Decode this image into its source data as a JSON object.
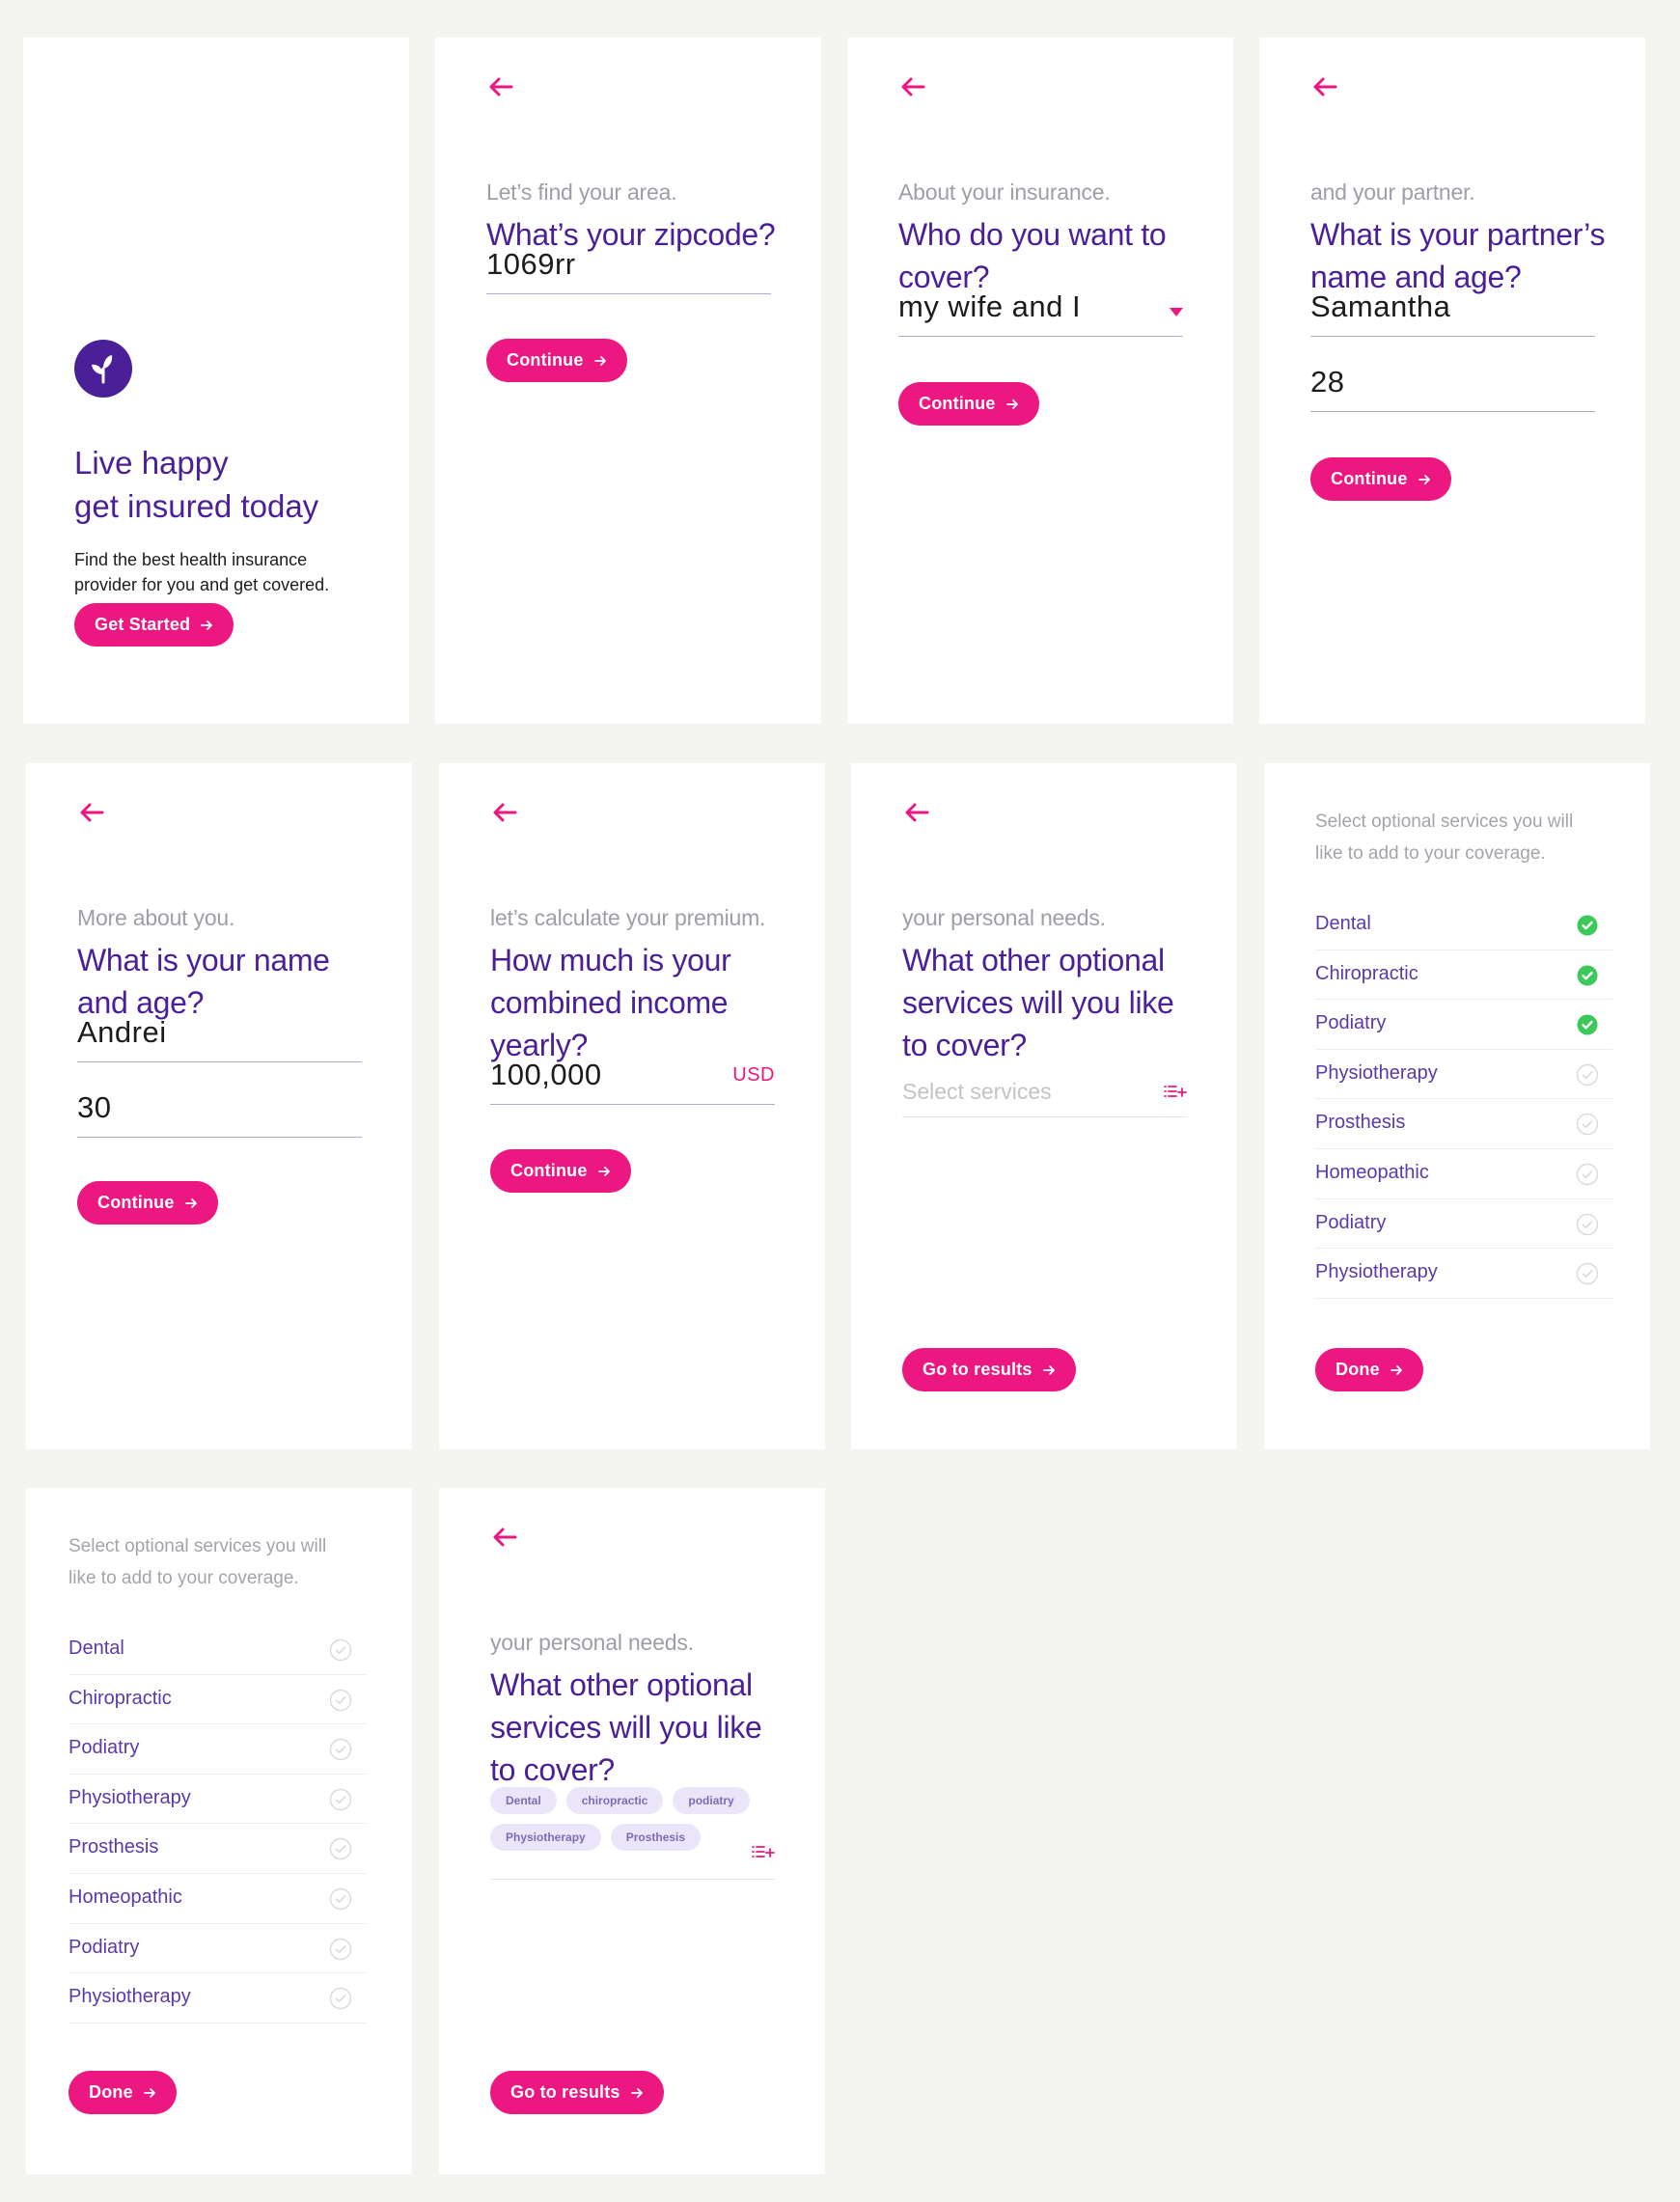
{
  "colors": {
    "accent": "#ec1780",
    "primary": "#4a1f98",
    "page_background": "#f4f4f0",
    "check_selected": "#3dc85a",
    "check_unselected": "#d9d9de"
  },
  "icons": {
    "back": "arrow-left-icon",
    "button_arrow": "arrow-right-icon",
    "logo": "sprout-icon",
    "dropdown": "caret-down-icon",
    "list_add": "list-add-icon",
    "check": "check-circle-icon"
  },
  "welcome": {
    "title_line1": "Live happy",
    "title_line2": "get insured today",
    "subtitle_line1": "Find the best health insurance",
    "subtitle_line2": "provider for you and get covered.",
    "button": "Get Started"
  },
  "zipcode": {
    "eyebrow": "Let’s find your area.",
    "question": "What’s your zipcode?",
    "value": "1069rr",
    "button": "Continue"
  },
  "cover": {
    "eyebrow": "About your insurance.",
    "question_line1": "Who do you want to",
    "question_line2": "cover?",
    "selected": "my wife and I",
    "button": "Continue"
  },
  "partner": {
    "eyebrow": "and your partner.",
    "question_line1": "What is your partner’s",
    "question_line2": "name and age?",
    "name": "Samantha",
    "age": "28",
    "button": "Continue"
  },
  "you": {
    "eyebrow": "More about you.",
    "question_line1": "What is your name",
    "question_line2": "and age?",
    "name": "Andrei",
    "age": "30",
    "button": "Continue"
  },
  "income": {
    "eyebrow": "let’s calculate your premium.",
    "question_line1": "How much is your",
    "question_line2": "combined income",
    "question_line3": "yearly?",
    "value": "100,000",
    "currency": "USD",
    "button": "Continue"
  },
  "services_empty": {
    "eyebrow": "your personal needs.",
    "question_line1": "What other optional",
    "question_line2": "services will you like",
    "question_line3": "to cover?",
    "placeholder": "Select services",
    "button": "Go to results"
  },
  "services_select": {
    "header_line1": "Select optional services you will",
    "header_line2": "like to add to your coverage.",
    "items": [
      {
        "label": "Dental",
        "selected": true
      },
      {
        "label": "Chiropractic",
        "selected": true
      },
      {
        "label": "Podiatry",
        "selected": true
      },
      {
        "label": "Physiotherapy",
        "selected": false
      },
      {
        "label": "Prosthesis",
        "selected": false
      },
      {
        "label": "Homeopathic",
        "selected": false
      },
      {
        "label": "Podiatry",
        "selected": false
      },
      {
        "label": "Physiotherapy",
        "selected": false
      }
    ],
    "button": "Done"
  },
  "services_select_empty": {
    "header_line1": "Select optional services you will",
    "header_line2": "like to add to your coverage.",
    "items": [
      {
        "label": "Dental",
        "selected": false
      },
      {
        "label": "Chiropractic",
        "selected": false
      },
      {
        "label": "Podiatry",
        "selected": false
      },
      {
        "label": "Physiotherapy",
        "selected": false
      },
      {
        "label": "Prosthesis",
        "selected": false
      },
      {
        "label": "Homeopathic",
        "selected": false
      },
      {
        "label": "Podiatry",
        "selected": false
      },
      {
        "label": "Physiotherapy",
        "selected": false
      }
    ],
    "button": "Done"
  },
  "services_chips": {
    "eyebrow": "your personal needs.",
    "question_line1": "What other optional",
    "question_line2": "services will you like",
    "question_line3": "to cover?",
    "chips_row1": [
      "Dental",
      "chiropractic",
      "podiatry"
    ],
    "chips_row2": [
      "Physiotherapy",
      "Prosthesis"
    ],
    "button": "Go to results"
  }
}
